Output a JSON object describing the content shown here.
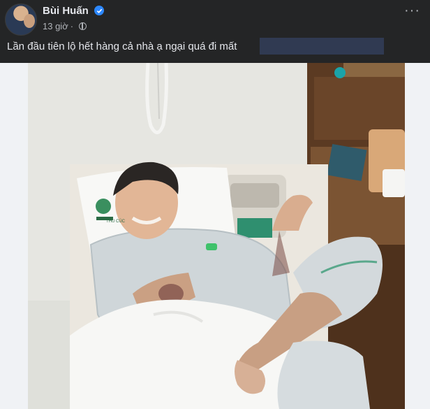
{
  "post": {
    "author": "Bùi Huấn",
    "time": "13 giờ",
    "text": "Lần đầu tiên lộ hết hàng cả nhà ạ ngại quá đi mất",
    "more_label": "···"
  },
  "photo": {
    "pillow_logo_text": "THU CÚC"
  },
  "colors": {
    "background": "#242526",
    "text_primary": "#e4e6eb",
    "text_secondary": "#b0b3b8",
    "verified": "#2d88ff",
    "photo_backdrop": "#f0f2f5"
  },
  "icons": [
    "verified-badge-icon",
    "globe-icon",
    "more-options-icon"
  ]
}
